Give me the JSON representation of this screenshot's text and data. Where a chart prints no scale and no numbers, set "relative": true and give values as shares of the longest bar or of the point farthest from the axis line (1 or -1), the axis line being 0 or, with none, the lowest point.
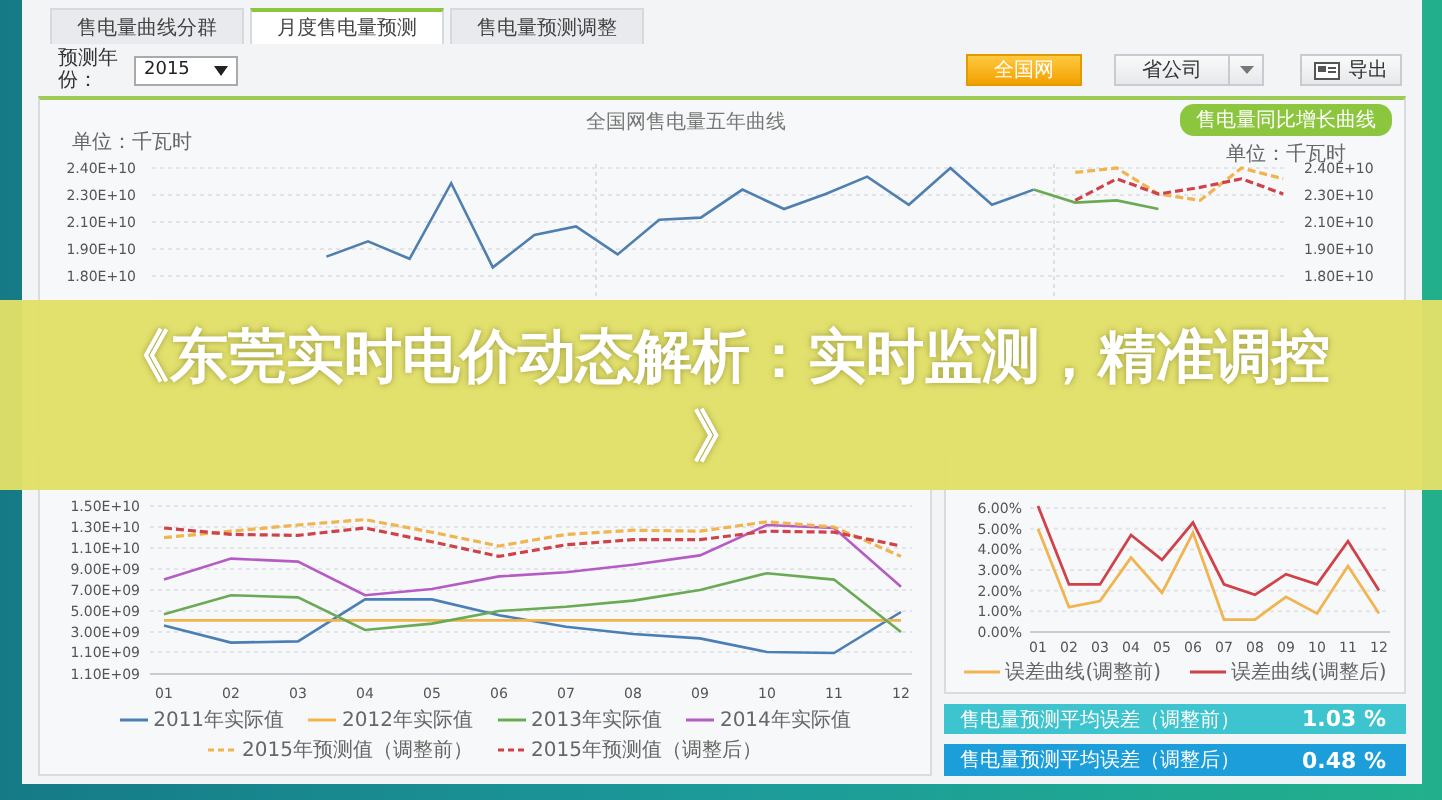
{
  "tabs": [
    {
      "label": "售电量曲线分群",
      "selected": false
    },
    {
      "label": "月度售电量预测",
      "selected": true
    },
    {
      "label": "售电量预测调整",
      "selected": false
    }
  ],
  "year_field": {
    "label": "预测年份：",
    "value": "2015"
  },
  "scope_buttons": [
    {
      "label": "全国网",
      "selected": true
    },
    {
      "label": "省公司",
      "selected": false
    }
  ],
  "export_button": {
    "label": "导出"
  },
  "five_year_chart": {
    "title": "全国网售电量五年曲线",
    "unit_left": "单位：千瓦时",
    "toggle": "售电量同比增长曲线",
    "unit_right": "单位：千瓦时",
    "left_ticks": [
      "2.40E+10",
      "2.30E+10",
      "2.10E+10",
      "1.90E+10",
      "1.80E+10"
    ],
    "right_ticks": [
      "2.40E+10",
      "2.30E+10",
      "2.10E+10",
      "1.90E+10",
      "1.80E+10"
    ],
    "chart_data": {
      "type": "line",
      "relative": true,
      "grid": true,
      "series": [
        {
          "color": "#4f7fae",
          "line_style": "solid",
          "values": [
            null,
            null,
            null,
            null,
            0.59,
            0.66,
            0.58,
            0.93,
            0.54,
            0.69,
            0.73,
            0.6,
            0.76,
            0.77,
            0.9,
            0.81,
            0.88,
            0.96,
            0.83,
            1,
            0.83,
            0.9,
            null,
            null,
            null,
            null,
            null,
            null
          ]
        },
        {
          "color": "#6aaa55",
          "line_style": "solid",
          "values": [
            null,
            null,
            null,
            null,
            null,
            null,
            null,
            null,
            null,
            null,
            null,
            null,
            null,
            null,
            null,
            null,
            null,
            null,
            null,
            null,
            null,
            0.9,
            0.84,
            0.85,
            0.81,
            null,
            null,
            null
          ]
        },
        {
          "color": "#f0b450",
          "line_style": "dashed",
          "values": [
            null,
            null,
            null,
            null,
            null,
            null,
            null,
            null,
            null,
            null,
            null,
            null,
            null,
            null,
            null,
            null,
            null,
            null,
            null,
            null,
            null,
            null,
            0.98,
            1,
            0.88,
            0.85,
            1,
            0.95
          ]
        },
        {
          "color": "#d0424a",
          "line_style": "dashed",
          "values": [
            null,
            null,
            null,
            null,
            null,
            null,
            null,
            null,
            null,
            null,
            null,
            null,
            null,
            null,
            null,
            null,
            null,
            null,
            null,
            null,
            null,
            null,
            0.85,
            0.95,
            0.88,
            0.91,
            0.95,
            0.88
          ]
        }
      ]
    }
  },
  "yearly_chart": {
    "bottom_label": "1.10E+09",
    "chart_data": {
      "type": "line",
      "grid": true,
      "ylim": [
        -1000000000.0,
        15000000000.0
      ],
      "categories": [
        "01",
        "02",
        "03",
        "04",
        "05",
        "06",
        "07",
        "08",
        "09",
        "10",
        "11",
        "12"
      ],
      "yticks": [
        {
          "value": 15000000000.0,
          "label": "1.50E+10"
        },
        {
          "value": 13000000000.0,
          "label": "1.30E+10"
        },
        {
          "value": 11000000000.0,
          "label": "1.10E+10"
        },
        {
          "value": 9000000000.0,
          "label": "9.00E+09"
        },
        {
          "value": 7000000000.0,
          "label": "7.00E+09"
        },
        {
          "value": 5000000000.0,
          "label": "5.00E+09"
        },
        {
          "value": 3000000000.0,
          "label": "3.00E+09"
        },
        {
          "value": 1100000000.0,
          "label": "1.10E+09"
        }
      ],
      "series": [
        {
          "name": "2011年实际值",
          "color": "#4a7fb5",
          "line_style": "solid",
          "values": [
            3600000000.0,
            2000000000.0,
            2100000000.0,
            6100000000.0,
            6100000000.0,
            4600000000.0,
            3500000000.0,
            2800000000.0,
            2400000000.0,
            1100000000.0,
            1000000000.0,
            4900000000.0
          ]
        },
        {
          "name": "2012年实际值",
          "color": "#f2b34a",
          "line_style": "solid",
          "values": [
            4100000000.0,
            4100000000.0,
            4100000000.0,
            4100000000.0,
            4100000000.0,
            4100000000.0,
            4100000000.0,
            4100000000.0,
            4100000000.0,
            4100000000.0,
            4100000000.0,
            4100000000.0
          ]
        },
        {
          "name": "2013年实际值",
          "color": "#6aaa55",
          "line_style": "solid",
          "values": [
            4700000000.0,
            6500000000.0,
            6300000000.0,
            3200000000.0,
            3800000000.0,
            5000000000.0,
            5400000000.0,
            6000000000.0,
            7000000000.0,
            8600000000.0,
            8000000000.0,
            3000000000.0
          ]
        },
        {
          "name": "2014年实际值",
          "color": "#b55cc4",
          "line_style": "solid",
          "values": [
            8000000000.0,
            10000000000.0,
            9700000000.0,
            6500000000.0,
            7100000000.0,
            8300000000.0,
            8700000000.0,
            9400000000.0,
            10300000000.0,
            13200000000.0,
            12900000000.0,
            7300000000.0
          ]
        },
        {
          "name": "2015年预测值（调整前）",
          "color": "#f0b450",
          "line_style": "dashed",
          "values": [
            12000000000.0,
            12600000000.0,
            13200000000.0,
            13700000000.0,
            12500000000.0,
            11200000000.0,
            12300000000.0,
            12700000000.0,
            12600000000.0,
            13500000000.0,
            13000000000.0,
            10200000000.0
          ]
        },
        {
          "name": "2015年预测值（调整后）",
          "color": "#d0424a",
          "line_style": "dashed",
          "values": [
            12900000000.0,
            12300000000.0,
            12200000000.0,
            12900000000.0,
            11600000000.0,
            10200000000.0,
            11300000000.0,
            11800000000.0,
            11800000000.0,
            12600000000.0,
            12500000000.0,
            11200000000.0
          ]
        }
      ]
    }
  },
  "error_chart": {
    "chart_data": {
      "type": "line",
      "grid": true,
      "ylim": [
        0,
        6.1
      ],
      "categories": [
        "01",
        "02",
        "03",
        "04",
        "05",
        "06",
        "07",
        "08",
        "09",
        "10",
        "11",
        "12"
      ],
      "yticks": [
        {
          "value": 6,
          "label": "6.00%"
        },
        {
          "value": 5,
          "label": "5.00%"
        },
        {
          "value": 4,
          "label": "4.00%"
        },
        {
          "value": 3,
          "label": "3.00%"
        },
        {
          "value": 2,
          "label": "2.00%"
        },
        {
          "value": 1,
          "label": "1.00%"
        },
        {
          "value": 0,
          "label": "0.00%"
        }
      ],
      "series": [
        {
          "name": "误差曲线(调整前)",
          "color": "#f0b450",
          "line_style": "solid",
          "values": [
            5.0,
            1.2,
            1.5,
            3.6,
            1.9,
            4.8,
            0.6,
            0.6,
            1.7,
            0.9,
            3.2,
            0.9
          ]
        },
        {
          "name": "误差曲线(调整后)",
          "color": "#d0424a",
          "line_style": "solid",
          "values": [
            6.1,
            2.3,
            2.3,
            4.7,
            3.5,
            5.3,
            2.3,
            1.8,
            2.8,
            2.3,
            4.4,
            2.0
          ]
        }
      ]
    }
  },
  "stats": [
    {
      "label": "售电量预测平均误差（调整前）",
      "value": "1.03 %",
      "color": "#3ec4cf"
    },
    {
      "label": "售电量预测平均误差（调整后）",
      "value": "0.48 %",
      "color": "#1b9ed9"
    }
  ],
  "banner": {
    "text": "《东莞实时电价动态解析：实时监测，精准调控》"
  }
}
